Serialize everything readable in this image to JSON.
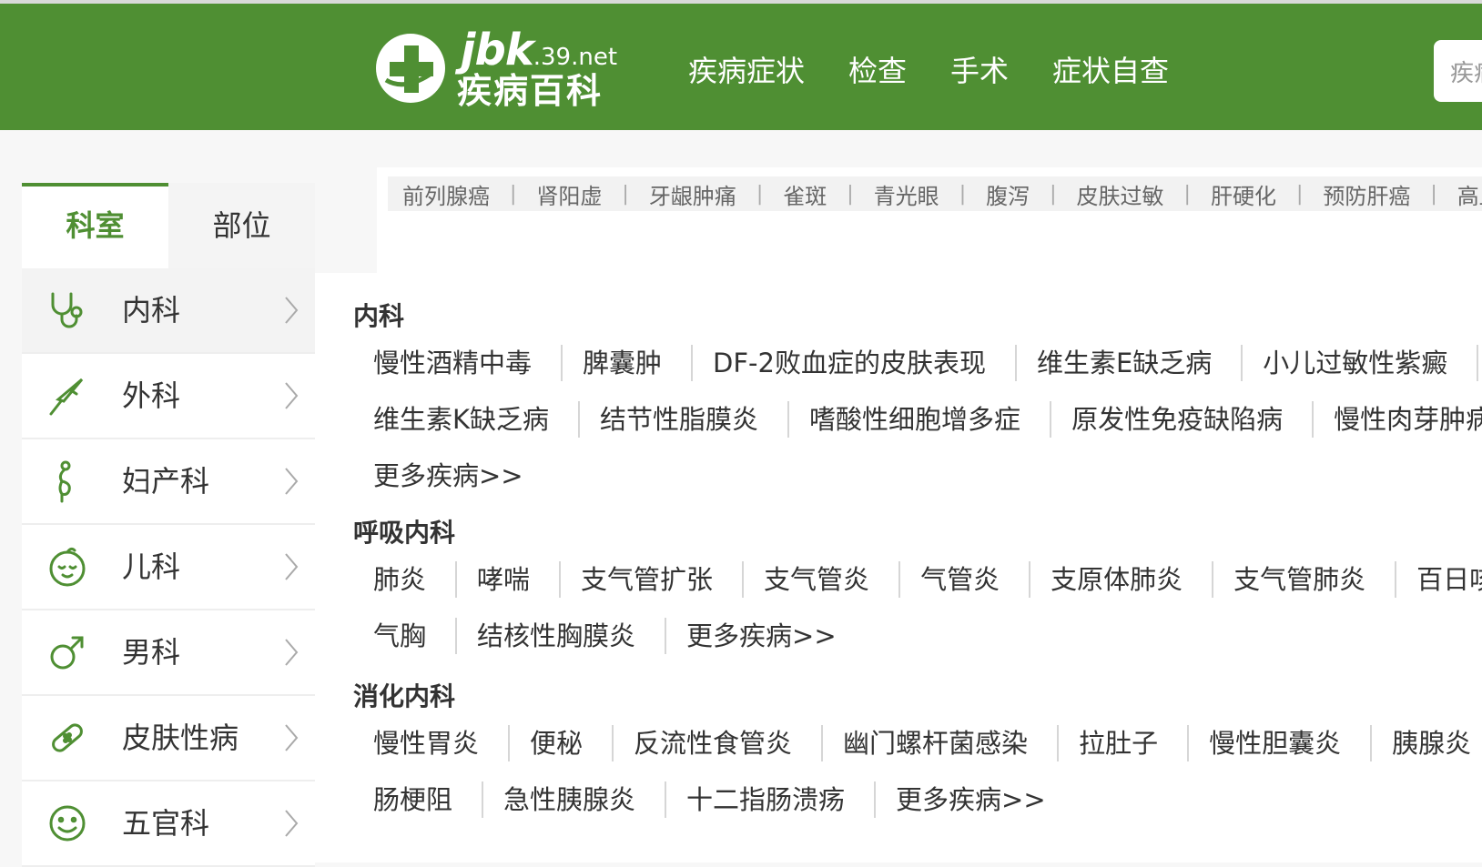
{
  "header": {
    "logo_brand": "jbk",
    "logo_domain": ".39.net",
    "logo_title": "疾病百科",
    "nav": [
      "疾病症状",
      "检查",
      "手术",
      "症状自查"
    ],
    "search_placeholder": "疾病"
  },
  "sidebar": {
    "tabs": [
      "科室",
      "部位"
    ],
    "active_tab": "科室",
    "departments": [
      {
        "label": "内科",
        "icon": "stethoscope-icon"
      },
      {
        "label": "外科",
        "icon": "scalpel-icon"
      },
      {
        "label": "妇产科",
        "icon": "pregnant-icon"
      },
      {
        "label": "儿科",
        "icon": "baby-face-icon"
      },
      {
        "label": "男科",
        "icon": "male-symbol-icon"
      },
      {
        "label": "皮肤性病",
        "icon": "bandage-icon"
      },
      {
        "label": "五官科",
        "icon": "smiley-icon"
      }
    ]
  },
  "hot_searches": [
    "前列腺癌",
    "肾阳虚",
    "牙龈肿痛",
    "雀斑",
    "青光眼",
    "腹泻",
    "皮肤过敏",
    "肝硬化",
    "预防肝癌",
    "高血"
  ],
  "sections": [
    {
      "title": "内科",
      "rows": [
        [
          "慢性酒精中毒",
          "脾囊肿",
          "DF-2败血症的皮肤表现",
          "维生素E缺乏病",
          "小儿过敏性紫癜"
        ],
        [
          "维生素K缺乏病",
          "结节性脂膜炎",
          "嗜酸性细胞增多症",
          "原发性免疫缺陷病",
          "慢性肉芽肿病"
        ]
      ],
      "more": "更多疾病>>"
    },
    {
      "title": "呼吸内科",
      "rows": [
        [
          "肺炎",
          "哮喘",
          "支气管扩张",
          "支气管炎",
          "气管炎",
          "支原体肺炎",
          "支气管肺炎",
          "百日咳"
        ],
        [
          "气胸",
          "结核性胸膜炎"
        ]
      ],
      "more": "更多疾病>>"
    },
    {
      "title": "消化内科",
      "rows": [
        [
          "慢性胃炎",
          "便秘",
          "反流性食管炎",
          "幽门螺杆菌感染",
          "拉肚子",
          "慢性胆囊炎",
          "胰腺炎"
        ],
        [
          "肠梗阻",
          "急性胰腺炎",
          "十二指肠溃疡"
        ]
      ],
      "more": "更多疾病>>"
    }
  ],
  "colors": {
    "brand_green": "#4f8f33"
  }
}
